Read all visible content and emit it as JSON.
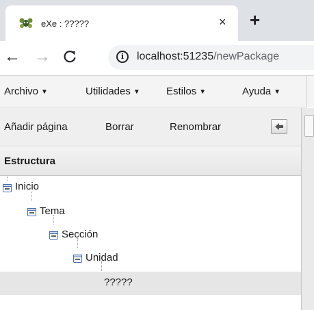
{
  "browser": {
    "tab_title": "eXe : ?????",
    "tab_close": "×",
    "new_tab": "+",
    "back": "←",
    "forward": "→",
    "reload": "C",
    "info": "i",
    "url_host": "localhost:51235",
    "url_path": "/newPackage"
  },
  "menu": {
    "items": [
      {
        "label": "Archivo",
        "caret": "▼"
      },
      {
        "label": "Utilidades",
        "caret": "▼"
      },
      {
        "label": "Estilos",
        "caret": "▼"
      },
      {
        "label": "Ayuda",
        "caret": "▼"
      }
    ]
  },
  "structure_toolbar": {
    "add_page": "Añadir página",
    "delete": "Borrar",
    "rename": "Renombrar"
  },
  "panel": {
    "title": "Estructura"
  },
  "tree": {
    "nodes": [
      {
        "label": "Inicio",
        "expanded": true,
        "selected": false
      },
      {
        "label": "Tema",
        "expanded": true,
        "selected": false
      },
      {
        "label": "Sección",
        "expanded": true,
        "selected": false
      },
      {
        "label": "Unidad",
        "expanded": true,
        "selected": false
      },
      {
        "label": "?????",
        "expanded": false,
        "selected": true
      }
    ]
  },
  "colors": {
    "tab_strip": "#dee1e6",
    "omnibox": "#f1f3f4",
    "menubar": "#f4f4f4",
    "selected_row": "#e6e6e6",
    "toggle_border": "#4a6fa5"
  }
}
